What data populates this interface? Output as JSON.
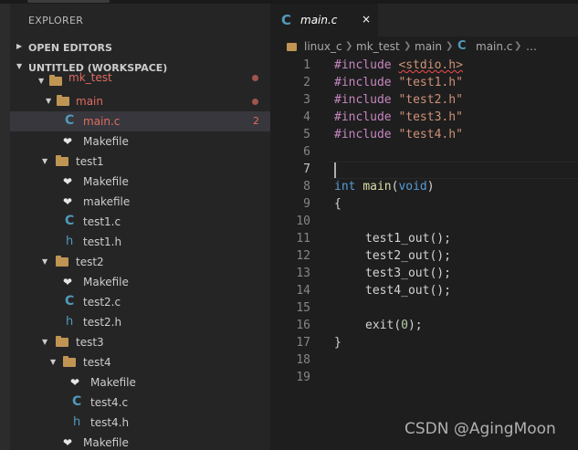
{
  "sidebar": {
    "title": "EXPLORER",
    "open_editors": "OPEN EDITORS",
    "workspace": "UNTITLED (WORKSPACE)",
    "tree": [
      {
        "label": "mk_test",
        "kind": "folder",
        "state": "dot"
      },
      {
        "label": "main",
        "kind": "folder",
        "state": "dot"
      },
      {
        "label": "main.c",
        "kind": "c",
        "badge": "2"
      },
      {
        "label": "Makefile",
        "kind": "makefile"
      },
      {
        "label": "test1",
        "kind": "folder"
      },
      {
        "label": "Makefile",
        "kind": "makefile"
      },
      {
        "label": "makefile",
        "kind": "makefile"
      },
      {
        "label": "test1.c",
        "kind": "c"
      },
      {
        "label": "test1.h",
        "kind": "h"
      },
      {
        "label": "test2",
        "kind": "folder"
      },
      {
        "label": "Makefile",
        "kind": "makefile"
      },
      {
        "label": "test2.c",
        "kind": "c"
      },
      {
        "label": "test2.h",
        "kind": "h"
      },
      {
        "label": "test3",
        "kind": "folder"
      },
      {
        "label": "test4",
        "kind": "folder"
      },
      {
        "label": "Makefile",
        "kind": "makefile"
      },
      {
        "label": "test4.c",
        "kind": "c"
      },
      {
        "label": "test4.h",
        "kind": "h"
      },
      {
        "label": "Makefile",
        "kind": "makefile"
      }
    ]
  },
  "editor": {
    "tab": {
      "icon": "C",
      "name": "main.c",
      "close": "×"
    },
    "breadcrumb": [
      "linux_c",
      "mk_test",
      "main",
      "main.c",
      "…"
    ],
    "line_numbers": [
      "1",
      "2",
      "3",
      "4",
      "5",
      "6",
      "7",
      "8",
      "9",
      "10",
      "11",
      "12",
      "13",
      "14",
      "15",
      "16",
      "17",
      "18",
      "19"
    ],
    "active_line": "7",
    "code": {
      "l1_dir": "#include",
      "l1_arg": "<stdio.h>",
      "l2_dir": "#include",
      "l2_arg": "\"test1.h\"",
      "l3_dir": "#include",
      "l3_arg": "\"test2.h\"",
      "l4_dir": "#include",
      "l4_arg": "\"test3.h\"",
      "l5_dir": "#include",
      "l5_arg": "\"test4.h\"",
      "l8_type": "int",
      "l8_fn": "main",
      "l8_open": "(",
      "l8_void": "void",
      "l8_close": ")",
      "l9": "{",
      "l11": "test1_out();",
      "l12": "test2_out();",
      "l13": "test3_out();",
      "l14": "test4_out();",
      "l16_fn": "exit",
      "l16_open": "(",
      "l16_num": "0",
      "l16_close": ");",
      "l17": "}"
    }
  },
  "watermark": "CSDN @AgingMoon",
  "colors": {
    "accent": "#519aba",
    "folder": "#c09553",
    "error": "#e06c60",
    "keyword": "#569cd6",
    "directive": "#c586c0",
    "string": "#ce9178"
  }
}
